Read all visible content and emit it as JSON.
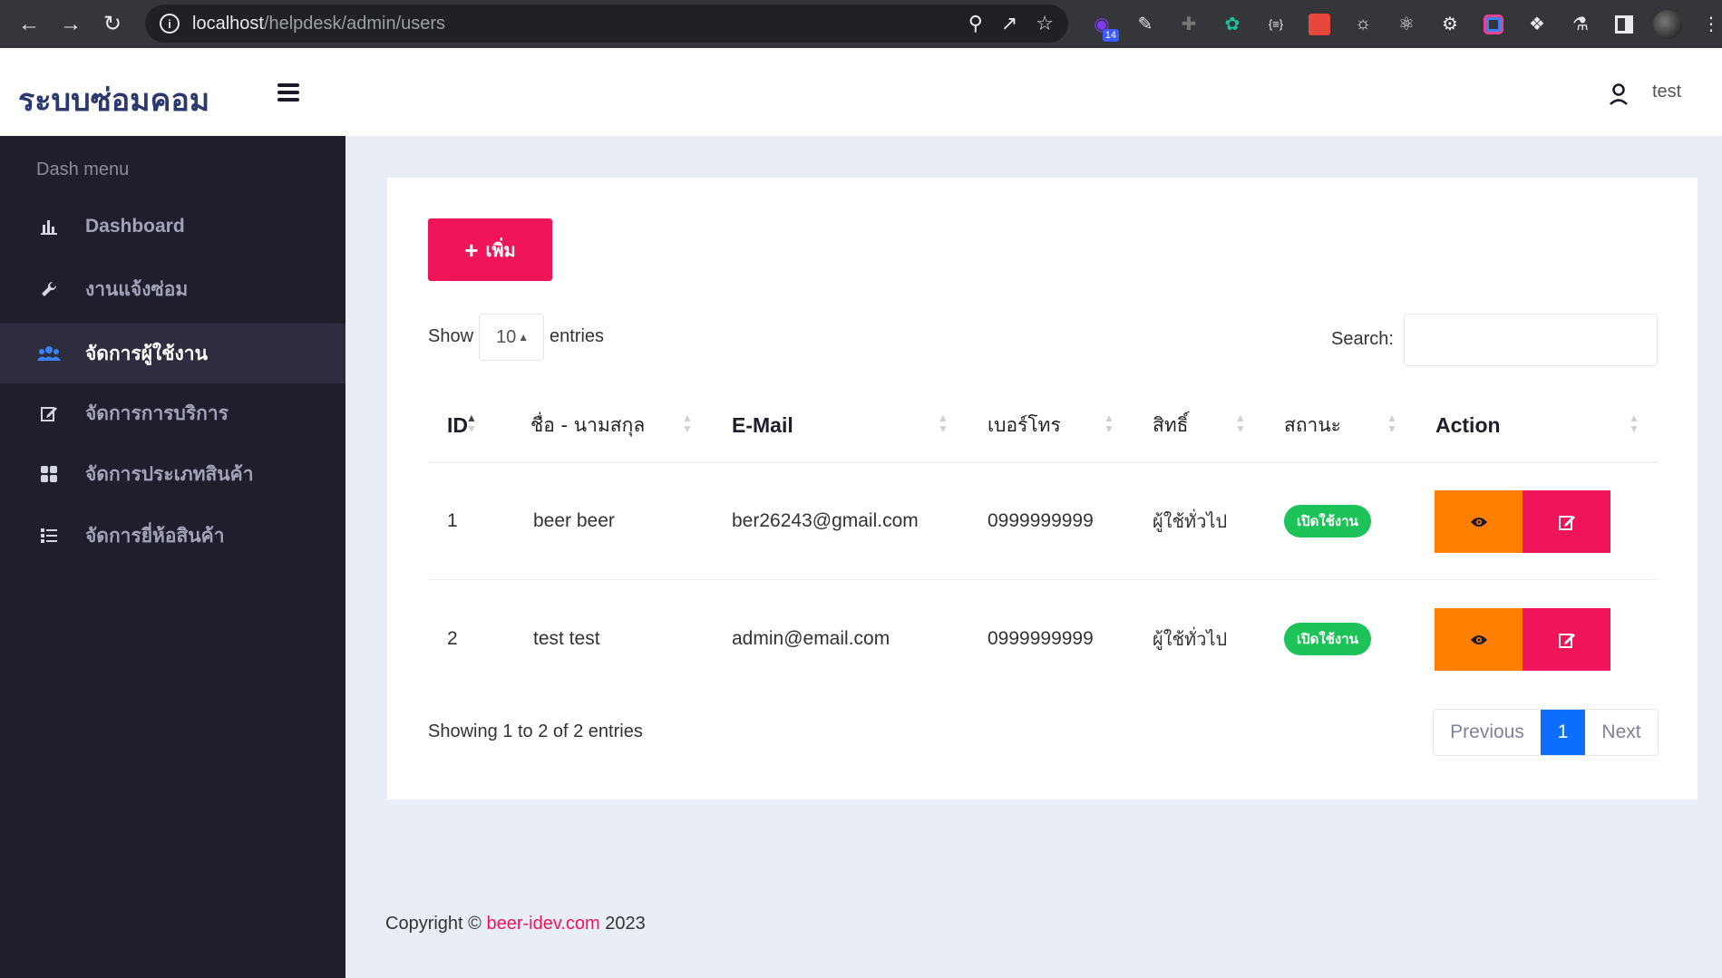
{
  "browser": {
    "url_host": "localhost",
    "url_path": "/helpdesk/admin/users",
    "ext_badge": "14"
  },
  "header": {
    "brand": "ระบบซ่อมคอม",
    "user": "test"
  },
  "sidebar": {
    "title": "Dash menu",
    "items": [
      {
        "label": "Dashboard",
        "icon": "bar-chart-icon"
      },
      {
        "label": "งานแจ้งซ่อม",
        "icon": "wrench-icon"
      },
      {
        "label": "จัดการผู้ใช้งาน",
        "icon": "users-icon",
        "active": true
      },
      {
        "label": "จัดการการบริการ",
        "icon": "edit-icon"
      },
      {
        "label": "จัดการประเภทสินค้า",
        "icon": "grid-icon"
      },
      {
        "label": "จัดการยี่ห้อสินค้า",
        "icon": "list-icon"
      }
    ]
  },
  "toolbar": {
    "add_label": "เพิ่ม"
  },
  "table_controls": {
    "show": "Show",
    "page_size": "10",
    "entries": "entries",
    "search_label": "Search:",
    "search_value": ""
  },
  "table": {
    "columns": [
      "ID",
      "ชื่อ - นามสกุล",
      "E-Mail",
      "เบอร์โทร",
      "สิทธิ์",
      "สถานะ",
      "Action"
    ],
    "rows": [
      {
        "id": "1",
        "name": "beer beer",
        "email": "ber26243@gmail.com",
        "phone": "0999999999",
        "role": "ผู้ใช้ทั่วไป",
        "status": "เปิดใช้งาน"
      },
      {
        "id": "2",
        "name": "test test",
        "email": "admin@email.com",
        "phone": "0999999999",
        "role": "ผู้ใช้ทั่วไป",
        "status": "เปิดใช้งาน"
      }
    ]
  },
  "footer_info": {
    "showing": "Showing 1 to 2 of 2 entries"
  },
  "pagination": {
    "previous": "Previous",
    "current": "1",
    "next": "Next"
  },
  "footer": {
    "prefix": "Copyright ©",
    "link": "beer-idev.com",
    "year": "2023"
  },
  "colors": {
    "sidebar_bg": "#1e1e2d",
    "accent_pink": "#f0145a",
    "accent_orange": "#ff8000",
    "status_green": "#1dc259",
    "page_active_blue": "#0d6efd"
  }
}
